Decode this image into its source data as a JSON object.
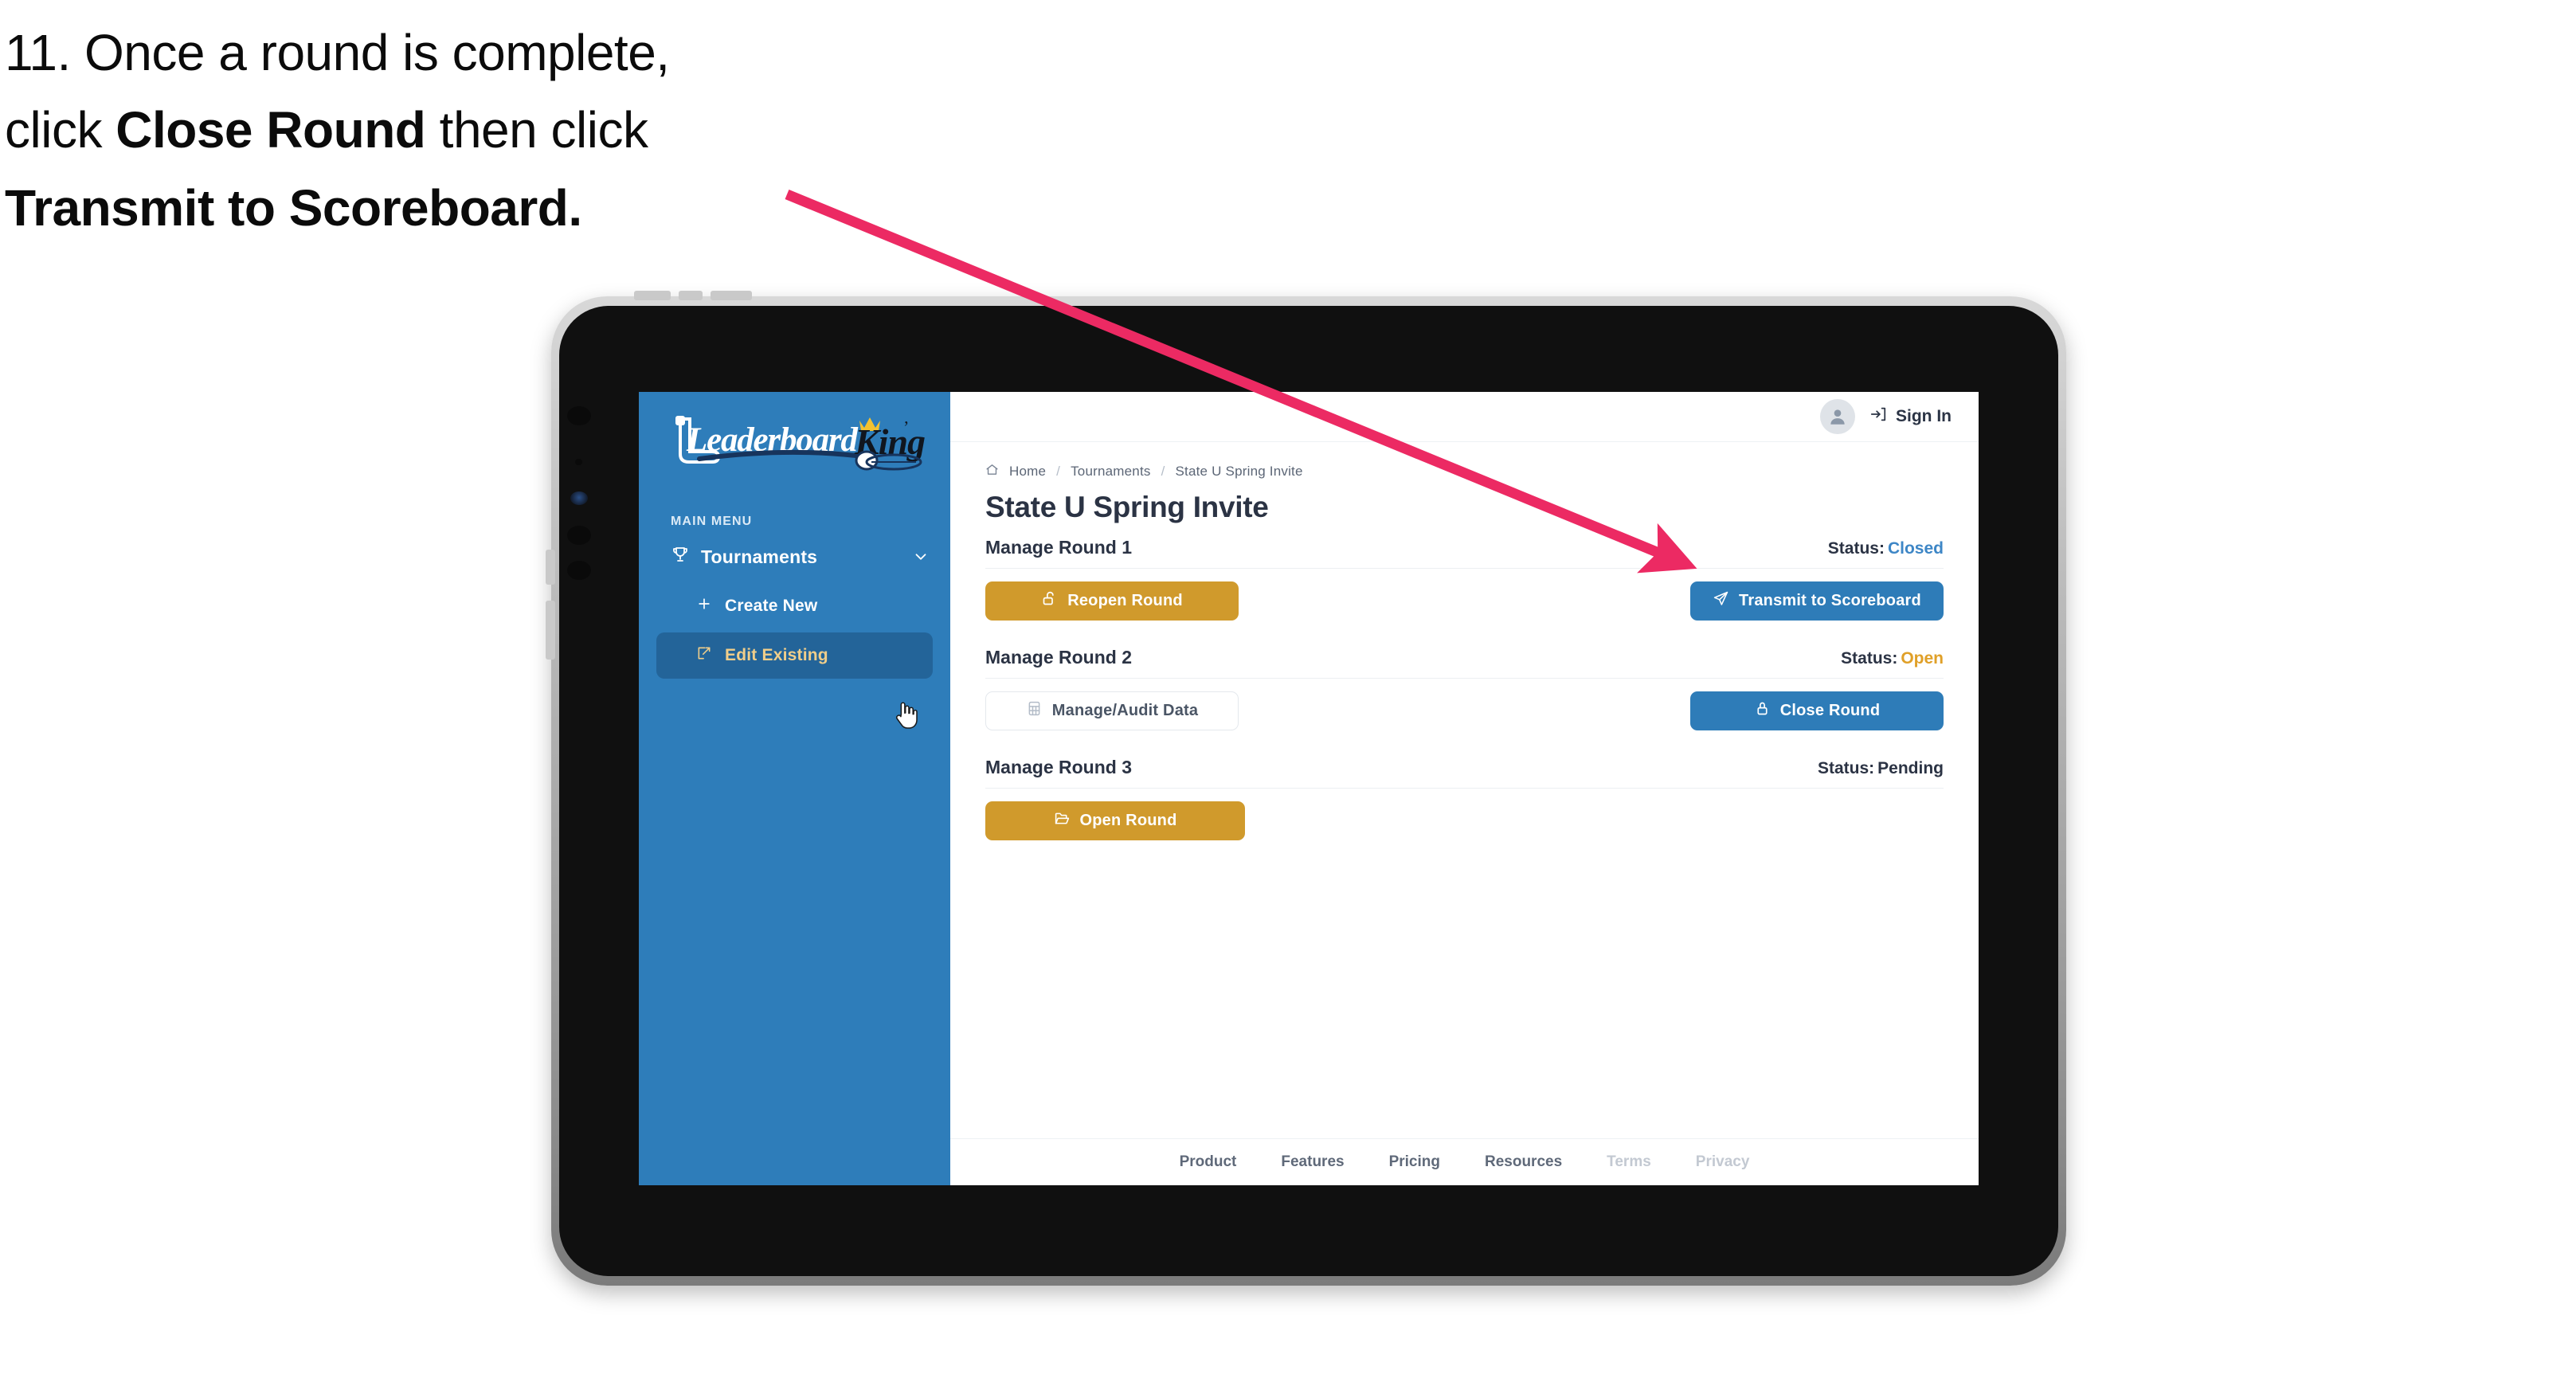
{
  "caption": {
    "line1_prefix": "11. Once a round is complete,",
    "line2_prefix": "click ",
    "line2_bold": "Close Round",
    "line2_suffix": " then click",
    "line3_bold": "Transmit to Scoreboard."
  },
  "device": {
    "type": "tablet"
  },
  "app": {
    "logo": {
      "word1": "Leaderboard",
      "word2": "King"
    },
    "sidebar": {
      "section_label": "MAIN MENU",
      "items": [
        {
          "label": "Tournaments",
          "icon": "trophy-icon",
          "expandable": true,
          "chevron": "chevron-down-icon"
        },
        {
          "label": "Create New",
          "icon": "plus-icon",
          "active": false
        },
        {
          "label": "Edit Existing",
          "icon": "edit-square-icon",
          "active": true
        }
      ],
      "cursor": "pointing-hand-cursor"
    },
    "topbar": {
      "avatar_icon": "user-avatar-icon",
      "signin_icon": "sign-in-icon",
      "signin_label": "Sign In"
    },
    "breadcrumb": {
      "home_icon": "home-icon",
      "items": [
        "Home",
        "Tournaments",
        "State U Spring Invite"
      ],
      "separator": "/"
    },
    "page_title": "State U Spring Invite",
    "rounds": [
      {
        "title": "Manage Round 1",
        "status_label": "Status:",
        "status_value": "Closed",
        "status_class": "st-closed",
        "left_button": {
          "label": "Reopen Round",
          "icon": "unlock-icon",
          "style": "gold"
        },
        "right_button": {
          "label": "Transmit to Scoreboard",
          "icon": "paper-plane-icon",
          "style": "blue"
        }
      },
      {
        "title": "Manage Round 2",
        "status_label": "Status:",
        "status_value": "Open",
        "status_class": "st-open",
        "left_button": {
          "label": "Manage/Audit Data",
          "icon": "table-grid-icon",
          "style": "ghost"
        },
        "right_button": {
          "label": "Close Round",
          "icon": "lock-icon",
          "style": "blue"
        }
      },
      {
        "title": "Manage Round 3",
        "status_label": "Status:",
        "status_value": "Pending",
        "status_class": "st-pending",
        "left_button": {
          "label": "Open Round",
          "icon": "folder-open-icon",
          "style": "gold"
        },
        "right_button": null
      }
    ],
    "footer_links": [
      {
        "label": "Product",
        "muted": false
      },
      {
        "label": "Features",
        "muted": false
      },
      {
        "label": "Pricing",
        "muted": false
      },
      {
        "label": "Resources",
        "muted": false
      },
      {
        "label": "Terms",
        "muted": true
      },
      {
        "label": "Privacy",
        "muted": true
      }
    ]
  },
  "colors": {
    "sidebar_blue": "#2E7DBA",
    "sidebar_active": "#236499",
    "sidebar_active_text": "#F0CE8A",
    "button_gold": "#D09A2C",
    "button_blue": "#2E7CB8",
    "status_closed": "#3D86C6",
    "status_open": "#E0A028",
    "annotation_arrow": "#EC2A63",
    "text_dark": "#2B3344"
  },
  "annotation": {
    "arrow_color": "#EC2A63",
    "points_to": "Transmit to Scoreboard"
  }
}
